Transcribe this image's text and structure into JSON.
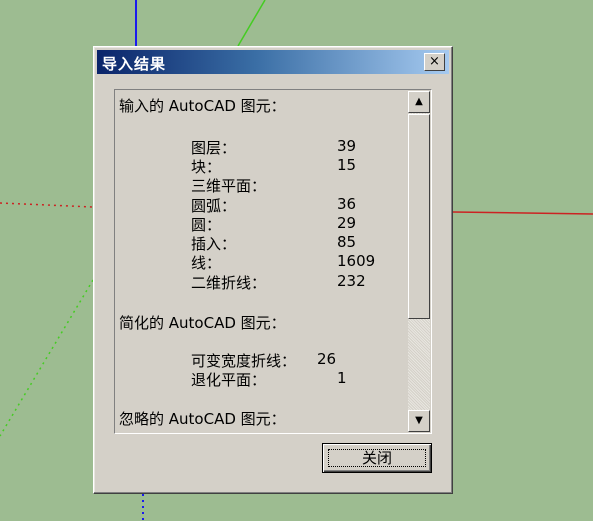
{
  "dialog": {
    "title": "导入结果",
    "close_icon": "×",
    "close_button_label": "关闭"
  },
  "sections": [
    {
      "header": "输入的 AutoCAD 图元：",
      "rows": [
        {
          "label": "图层：",
          "value": "39"
        },
        {
          "label": "块：",
          "value": "15"
        },
        {
          "label": "三维平面：",
          "value": ""
        },
        {
          "label": "圆弧：",
          "value": "36"
        },
        {
          "label": "圆：",
          "value": "29"
        },
        {
          "label": "插入：",
          "value": "85"
        },
        {
          "label": "线：",
          "value": "1609"
        },
        {
          "label": "二维折线：",
          "value": "232"
        }
      ]
    },
    {
      "header": "简化的 AutoCAD 图元：",
      "rows": [
        {
          "label": "可变宽度折线：",
          "value": "26"
        },
        {
          "label": "退化平面：",
          "value": "1"
        }
      ]
    },
    {
      "header": "忽略的 AutoCAD 图元：",
      "rows": []
    }
  ],
  "scrollbar": {
    "up_icon": "▲",
    "down_icon": "▼"
  },
  "colors": {
    "viewport_background": "#9dbc91",
    "axis_green": "#44cc22",
    "axis_red": "#cc2222",
    "axis_blue": "#1a1aee",
    "title_gradient_start": "#0a246a",
    "title_gradient_end": "#a6caf0"
  }
}
